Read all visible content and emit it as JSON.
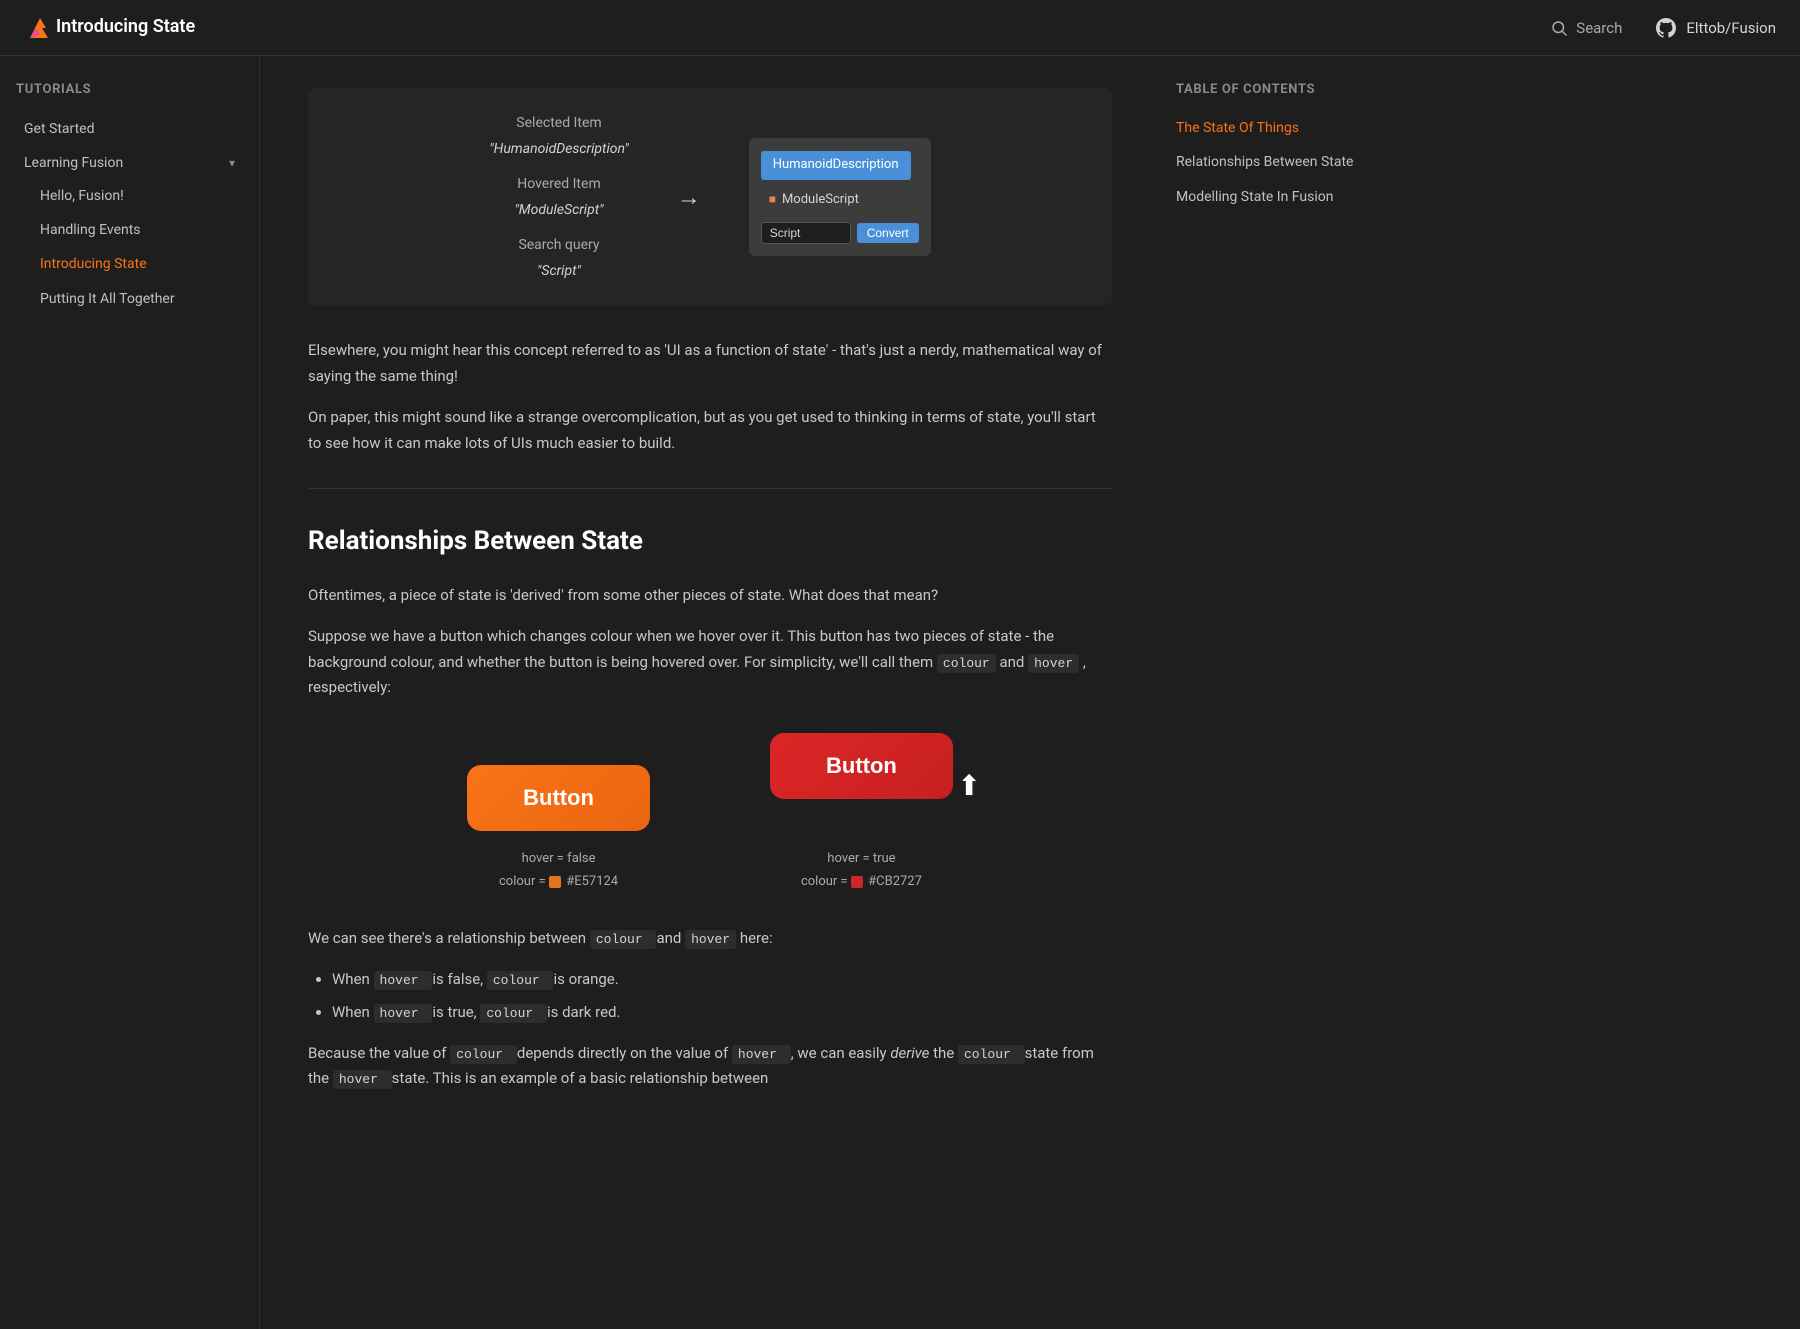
{
  "header": {
    "title": "Introducing State",
    "search_placeholder": "Search",
    "github_label": "Elttob/Fusion"
  },
  "sidebar": {
    "tutorials_label": "Tutorials",
    "get_started_label": "Get Started",
    "learning_fusion_label": "Learning Fusion",
    "children": [
      {
        "label": "Hello, Fusion!"
      },
      {
        "label": "Handling Events"
      },
      {
        "label": "Introducing State",
        "active": true
      },
      {
        "label": "Putting It All Together"
      }
    ]
  },
  "toc": {
    "title": "Table of contents",
    "items": [
      {
        "label": "The State Of Things",
        "active": true
      },
      {
        "label": "Relationships Between State",
        "active": false
      },
      {
        "label": "Modelling State In Fusion",
        "active": false
      }
    ]
  },
  "demo": {
    "selected_item_label": "Selected Item",
    "selected_item_value": "\"HumanoidDescription\"",
    "hovered_item_label": "Hovered Item",
    "hovered_item_value": "\"ModuleScript\"",
    "search_query_label": "Search query",
    "search_query_value": "\"Script\"",
    "ui_selected": "HumanoidDescription",
    "ui_module": "ModuleScript",
    "ui_input_value": "Script",
    "ui_convert_btn": "Convert"
  },
  "content": {
    "para1": "Elsewhere, you might hear this concept referred to as 'UI as a function of state' - that's just a nerdy, mathematical way of saying the same thing!",
    "para2": "On paper, this might sound like a strange overcomplication, but as you get used to thinking in terms of state, you'll start to see how it can make lots of UIs much easier to build.",
    "section_heading": "Relationships Between State",
    "section_para1": "Oftentimes, a piece of state is 'derived' from some other pieces of state. What does that mean?",
    "section_para2": "Suppose we have a button which changes colour when we hover over it. This button has two pieces of state - the background colour, and whether the button is being hovered over. For simplicity, we'll call them",
    "code1": "colour",
    "and_text": "and",
    "code2": "hover",
    "respectively_text": ", respectively:",
    "button_label": "Button",
    "button_label2": "Button",
    "hover_false_label": "hover = false",
    "colour_false_label": "colour = ",
    "colour_false_value": "#E57124",
    "hover_true_label": "hover = true",
    "colour_true_label": "colour = ",
    "colour_true_value": "#CB2727",
    "para3_start": "We can see there's a relationship between",
    "para3_code1": "colour",
    "para3_and": "and",
    "para3_code2": "hover",
    "para3_end": "here:",
    "bullet1_start": "When",
    "bullet1_code": "hover",
    "bullet1_end": "is false,",
    "bullet1_code2": "colour",
    "bullet1_final": "is orange.",
    "bullet2_start": "When",
    "bullet2_code": "hover",
    "bullet2_end": "is true,",
    "bullet2_code2": "colour",
    "bullet2_final": "is dark red.",
    "para4_start": "Because the value of",
    "para4_code1": "colour",
    "para4_middle": "depends directly on the value of",
    "para4_code2": "hover",
    "para4_end": ", we can easily",
    "para4_italic": "derive",
    "para4_final": "the",
    "para4_code3": "colour",
    "para4_last": "state from the",
    "para4_code4": "hover",
    "para4_trailing": "state. This is an example of a basic relationship between"
  },
  "colors": {
    "orange_btn": "#E57124",
    "red_btn": "#CB2727",
    "active_nav": "#f97316",
    "accent_blue": "#4a90d9"
  }
}
